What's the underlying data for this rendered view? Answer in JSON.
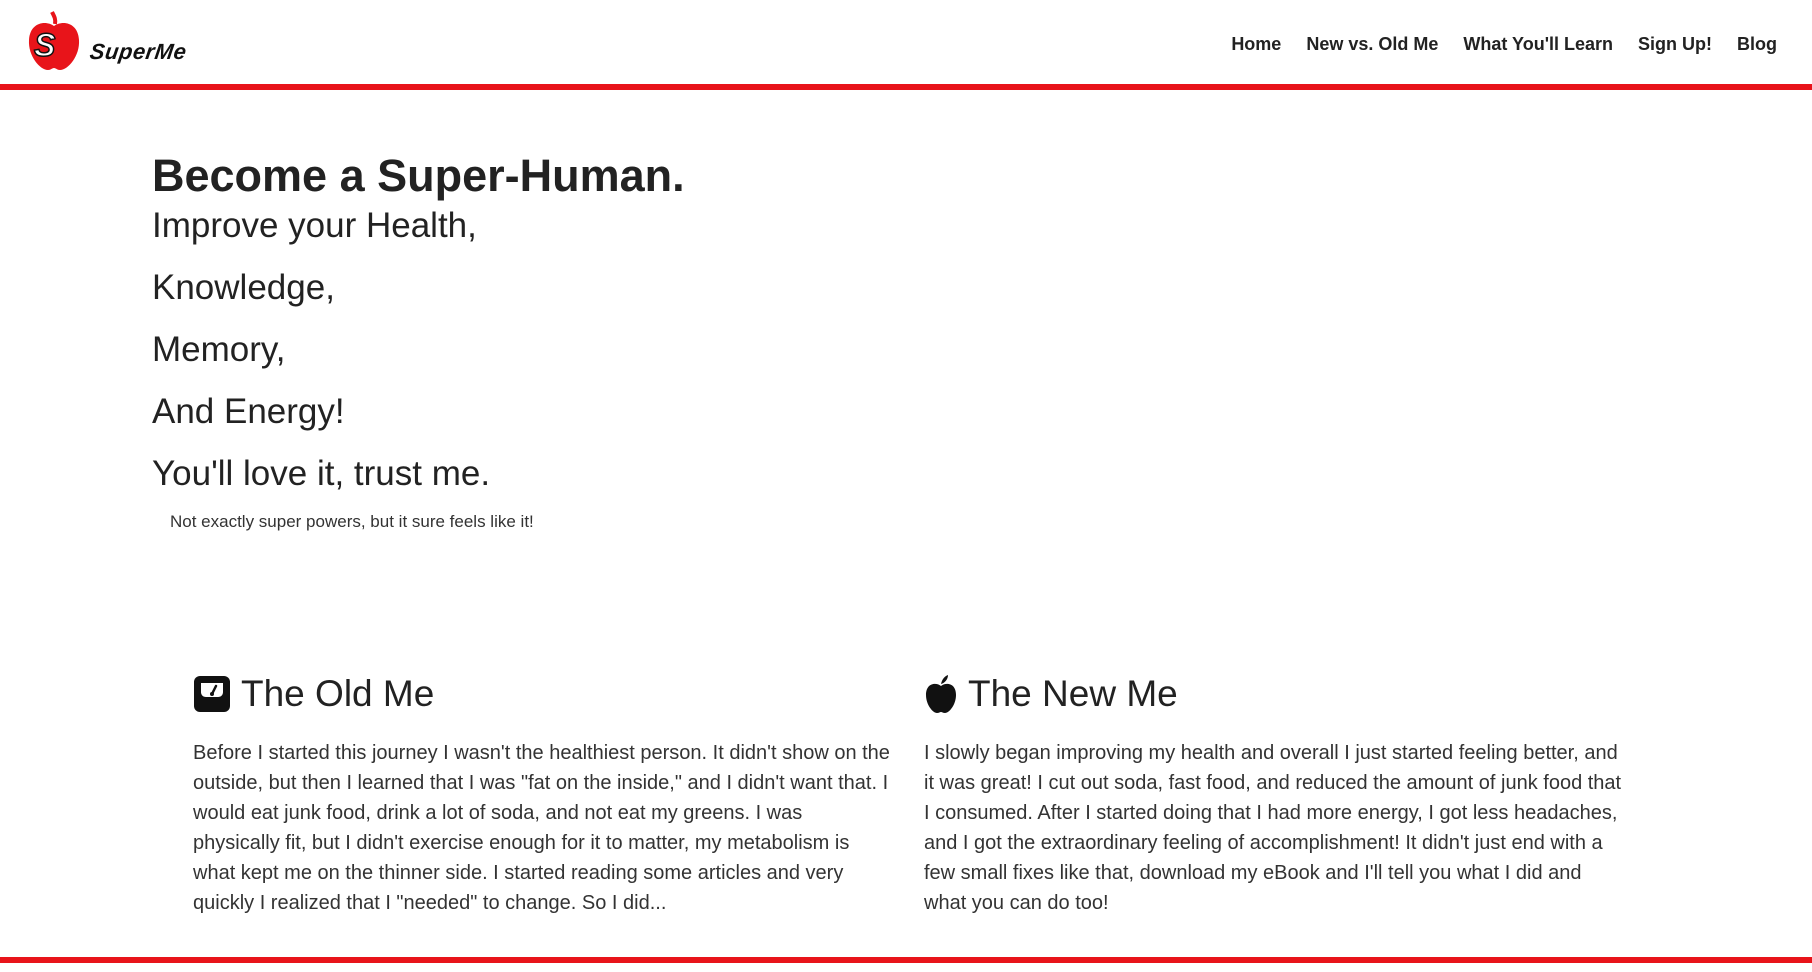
{
  "brand": {
    "logo_text": "SuperMe",
    "accent_color": "#e8141a"
  },
  "nav": {
    "items": [
      {
        "label": "Home"
      },
      {
        "label": "New vs. Old Me"
      },
      {
        "label": "What You'll Learn"
      },
      {
        "label": "Sign Up!"
      },
      {
        "label": "Blog"
      }
    ]
  },
  "hero": {
    "title": "Become a Super-Human.",
    "lines": [
      "Improve your Health,",
      "Knowledge,",
      "Memory,",
      "And Energy!",
      "You'll love it, trust me."
    ],
    "note": "Not exactly super powers, but it sure feels like it!"
  },
  "old_me": {
    "icon": "scale-icon",
    "heading": "The Old Me",
    "body": "Before I started this journey I wasn't the healthiest person. It didn't show on the outside, but then I learned that I was \"fat on the inside,\" and I didn't want that. I would eat junk food, drink a lot of soda, and not eat my greens. I was physically fit, but I didn't exercise enough for it to matter, my metabolism is what kept me on the thinner side. I started reading some articles and very quickly I realized that I \"needed\" to change. So I did..."
  },
  "new_me": {
    "icon": "apple-icon",
    "heading": "The New Me",
    "body": "I slowly began improving my health and overall I just started feeling better, and it was great! I cut out soda, fast food, and reduced the amount of junk food that I consumed. After I started doing that I had more energy, I got less headaches, and I got the extraordinary feeling of accomplishment! It didn't just end with a few small fixes like that, download my eBook and I'll tell you what I did and what you can do too!"
  }
}
